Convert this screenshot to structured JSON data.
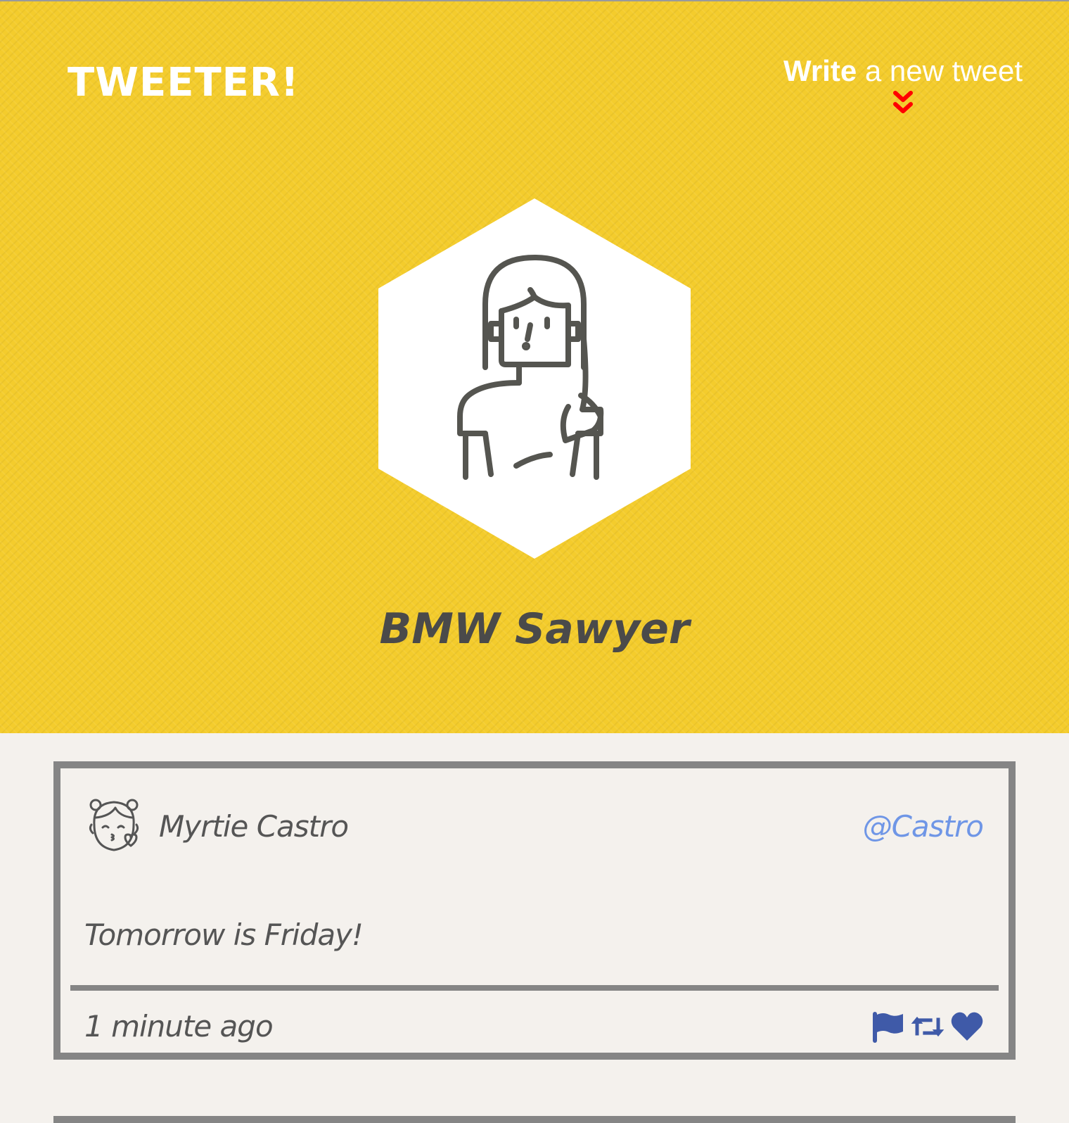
{
  "app": {
    "brand": "TWEETER!"
  },
  "compose": {
    "label_bold": "Write",
    "label_rest": " a new tweet",
    "arrow_icon": "double-chevron-down-icon",
    "arrow_color": "#ff0000"
  },
  "profile": {
    "name": "BMW Sawyer",
    "avatar_icon": "woman-avatar-icon"
  },
  "tweets": [
    {
      "author": "Myrtie Castro",
      "handle": "@Castro",
      "body": "Tomorrow is Friday!",
      "time": "1 minute ago",
      "avatar_icon": "kissing-girl-avatar-icon",
      "actions": [
        "flag-icon",
        "retweet-icon",
        "heart-icon"
      ]
    }
  ],
  "colors": {
    "header_yellow": "#f4cc2c",
    "page_bg": "#f4f1ed",
    "card_border": "#858585",
    "handle_blue": "#6f96e6",
    "action_blue": "#3f5aa8",
    "text_gray": "#555555"
  }
}
